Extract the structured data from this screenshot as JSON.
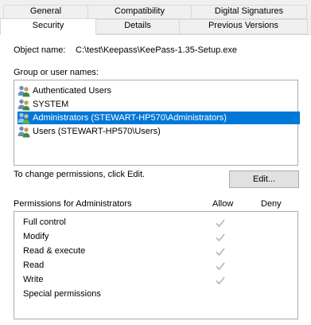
{
  "tabs": {
    "row1": [
      "General",
      "Compatibility",
      "Digital Signatures"
    ],
    "row2": [
      "Security",
      "Details",
      "Previous Versions"
    ]
  },
  "object": {
    "label": "Object name:",
    "value": "C:\\test\\Keepass\\KeePass-1.35-Setup.exe"
  },
  "groups": {
    "label": "Group or user names:",
    "items": [
      {
        "name": "Authenticated Users",
        "selected": false
      },
      {
        "name": "SYSTEM",
        "selected": false
      },
      {
        "name": "Administrators (STEWART-HP570\\Administrators)",
        "selected": true
      },
      {
        "name": "Users (STEWART-HP570\\Users)",
        "selected": false
      }
    ]
  },
  "change_hint": "To change permissions, click Edit.",
  "edit_button": "Edit...",
  "permissions": {
    "title": "Permissions for Administrators",
    "allow_header": "Allow",
    "deny_header": "Deny",
    "rows": [
      {
        "name": "Full control",
        "allow": true
      },
      {
        "name": "Modify",
        "allow": true
      },
      {
        "name": "Read & execute",
        "allow": true
      },
      {
        "name": "Read",
        "allow": true
      },
      {
        "name": "Write",
        "allow": true
      },
      {
        "name": "Special permissions",
        "allow": false
      }
    ]
  },
  "colors": {
    "selection": "#0078d7",
    "check": "#b5b5b5"
  }
}
